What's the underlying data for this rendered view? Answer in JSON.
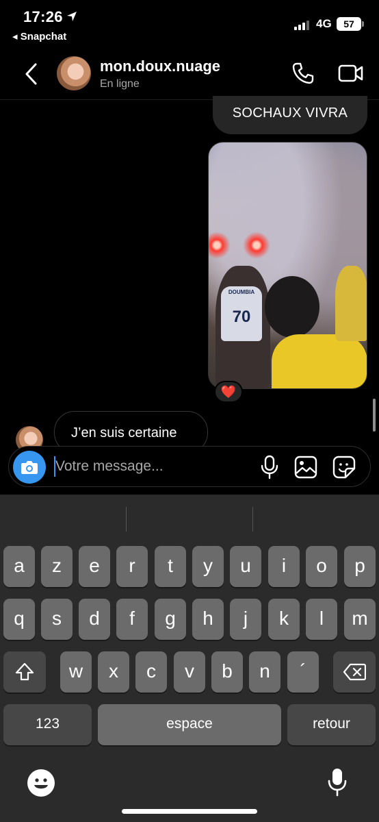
{
  "status_bar": {
    "time": "17:26",
    "back_app": "◂ Snapchat",
    "network": "4G",
    "battery": "57"
  },
  "header": {
    "username": "mon.doux.nuage",
    "presence": "En ligne"
  },
  "messages": {
    "outgoing_text": "SOCHAUX VIVRA",
    "photo_jersey_name": "DOUMBIA",
    "photo_jersey_number": "70",
    "reaction": "❤️",
    "incoming_text": "J’en suis certaine"
  },
  "composer": {
    "placeholder": "Votre message..."
  },
  "keyboard": {
    "row1": [
      "a",
      "z",
      "e",
      "r",
      "t",
      "y",
      "u",
      "i",
      "o",
      "p"
    ],
    "row2": [
      "q",
      "s",
      "d",
      "f",
      "g",
      "h",
      "j",
      "k",
      "l",
      "m"
    ],
    "row3": [
      "w",
      "x",
      "c",
      "v",
      "b",
      "n",
      "´"
    ],
    "numbers_label": "123",
    "space_label": "espace",
    "return_label": "retour"
  },
  "colors": {
    "accent": "#3797f0",
    "bubble_out": "#262626",
    "keyboard_bg": "#2b2b2b",
    "key_bg": "#6b6b6b",
    "key_dark_bg": "#474747"
  }
}
